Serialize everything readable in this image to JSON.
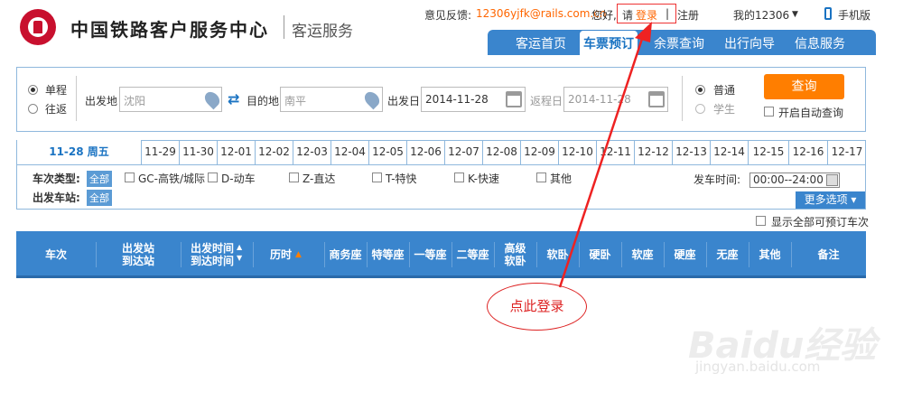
{
  "header": {
    "brand": "中国铁路客户服务中心",
    "sub": "客运服务",
    "feedback_label": "意见反馈:",
    "feedback_email": "12306yjfk@rails.com.cn",
    "greeting": "您好,",
    "please": "请",
    "login": "登录",
    "divider": "|",
    "register": "注册",
    "my12306": "我的12306",
    "mobile": "手机版"
  },
  "nav": [
    "客运首页",
    "车票预订",
    "余票查询",
    "出行向导",
    "信息服务"
  ],
  "search": {
    "single": "单程",
    "round": "往返",
    "from_label": "出发地",
    "from_value": "沈阳",
    "to_label": "目的地",
    "to_value": "南平",
    "date_label": "出发日",
    "date_value": "2014-11-28",
    "return_label": "返程日",
    "return_value": "2014-11-28",
    "normal": "普通",
    "student": "学生",
    "query": "查询",
    "auto_query": "开启自动查询"
  },
  "dates": [
    "11-28 周五",
    "11-29",
    "11-30",
    "12-01",
    "12-02",
    "12-03",
    "12-04",
    "12-05",
    "12-06",
    "12-07",
    "12-08",
    "12-09",
    "12-10",
    "12-11",
    "12-12",
    "12-13",
    "12-14",
    "12-15",
    "12-16",
    "12-17"
  ],
  "filters": {
    "type_label": "车次类型:",
    "all": "全部",
    "types": [
      "GC-高铁/城际",
      "D-动车",
      "Z-直达",
      "T-特快",
      "K-快速",
      "其他"
    ],
    "station_label": "出发车站:",
    "depart_time_label": "发车时间:",
    "depart_time_value": "00:00--24:00",
    "more": "更多选项",
    "show_all": "显示全部可预订车次"
  },
  "table_headers": [
    "车次",
    "出发站\n到达站",
    "出发时间\n到达时间",
    "历时",
    "商务座",
    "特等座",
    "一等座",
    "二等座",
    "高级\n软卧",
    "软卧",
    "硬卧",
    "软座",
    "硬座",
    "无座",
    "其他",
    "备注"
  ],
  "annotation": "点此登录",
  "watermark": "Baidu经验",
  "watermark_url": "jingyan.baidu.com",
  "colors": {
    "accent": "#3a85cd",
    "query_button": "#ff7e00",
    "annotation": "#d22"
  }
}
